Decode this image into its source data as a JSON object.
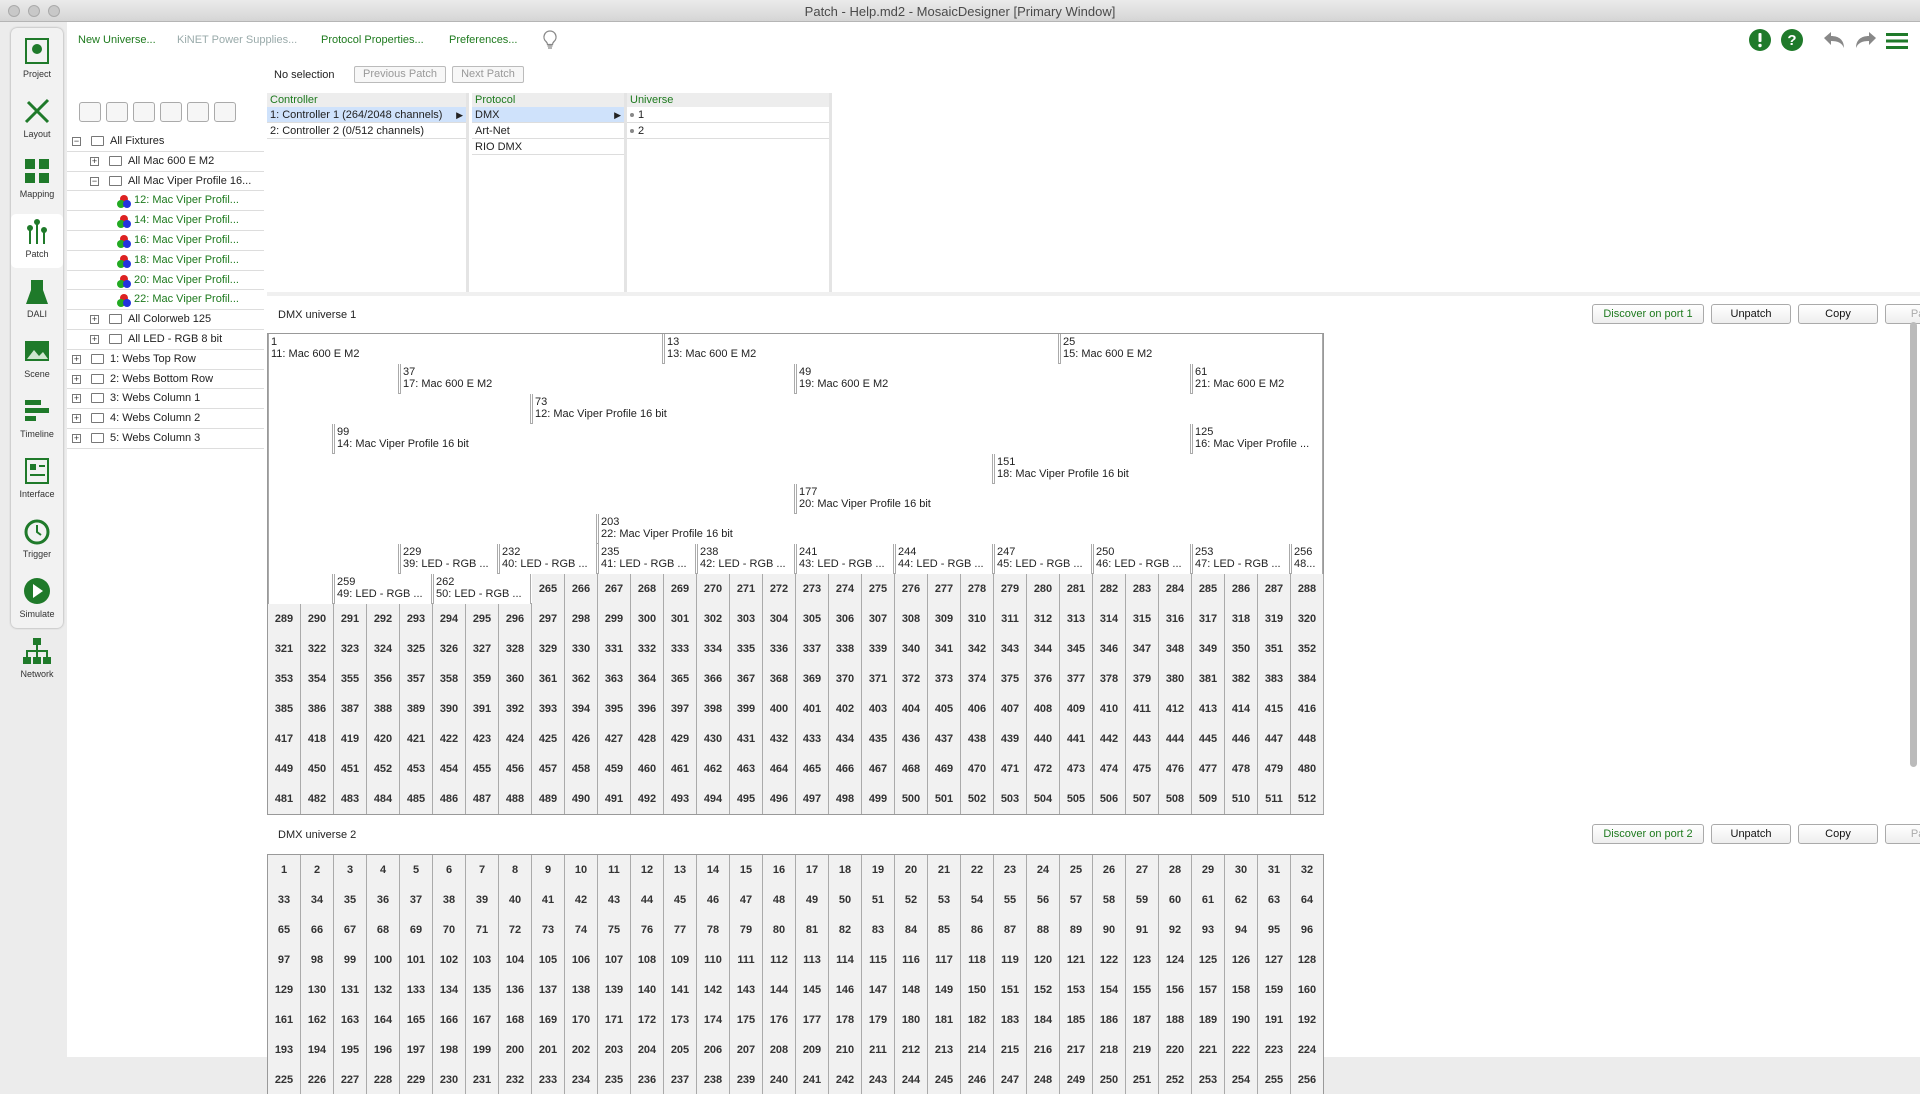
{
  "window": {
    "title": "Patch - Help.md2 - MosaicDesigner [Primary Window]"
  },
  "sidebar": {
    "items": [
      {
        "label": "Project",
        "icon": "project-icon"
      },
      {
        "label": "Layout",
        "icon": "layout-icon"
      },
      {
        "label": "Mapping",
        "icon": "mapping-icon"
      },
      {
        "label": "Patch",
        "icon": "patch-icon",
        "active": true
      },
      {
        "label": "DALI",
        "icon": "dali-icon"
      },
      {
        "label": "Scene",
        "icon": "scene-icon"
      },
      {
        "label": "Timeline",
        "icon": "timeline-icon"
      },
      {
        "label": "Interface",
        "icon": "interface-icon"
      },
      {
        "label": "Trigger",
        "icon": "trigger-icon"
      },
      {
        "label": "Simulate",
        "icon": "simulate-icon"
      },
      {
        "label": "Network",
        "icon": "network-icon"
      }
    ]
  },
  "toolbar": {
    "new_universe": "New Universe...",
    "kinet": "KiNET Power Supplies...",
    "protocol_props": "Protocol Properties...",
    "preferences": "Preferences...",
    "icons": [
      "lightbulb-icon",
      "warning-icon",
      "help-icon",
      "undo-icon",
      "redo-icon",
      "menu-icon"
    ]
  },
  "selection": {
    "status": "No selection",
    "prev": "Previous Patch",
    "next": "Next Patch"
  },
  "tree": {
    "items": [
      {
        "label": "All Fixtures",
        "indent": 0,
        "exp": "−",
        "kind": "folder"
      },
      {
        "label": "All Mac 600 E M2",
        "indent": 1,
        "exp": "+",
        "kind": "folder"
      },
      {
        "label": "All Mac Viper Profile 16...",
        "indent": 1,
        "exp": "−",
        "kind": "folder"
      },
      {
        "label": "12: Mac Viper Profil...",
        "indent": 2,
        "kind": "fixture"
      },
      {
        "label": "14: Mac Viper Profil...",
        "indent": 2,
        "kind": "fixture"
      },
      {
        "label": "16: Mac Viper Profil...",
        "indent": 2,
        "kind": "fixture"
      },
      {
        "label": "18: Mac Viper Profil...",
        "indent": 2,
        "kind": "fixture"
      },
      {
        "label": "20: Mac Viper Profil...",
        "indent": 2,
        "kind": "fixture"
      },
      {
        "label": "22: Mac Viper Profil...",
        "indent": 2,
        "kind": "fixture"
      },
      {
        "label": "All Colorweb 125",
        "indent": 1,
        "exp": "+",
        "kind": "folder"
      },
      {
        "label": "All LED - RGB 8 bit",
        "indent": 1,
        "exp": "+",
        "kind": "folder"
      },
      {
        "label": "1: Webs Top Row",
        "indent": 0,
        "exp": "+",
        "kind": "folder"
      },
      {
        "label": "2: Webs Bottom Row",
        "indent": 0,
        "exp": "+",
        "kind": "folder"
      },
      {
        "label": "3: Webs Column 1",
        "indent": 0,
        "exp": "+",
        "kind": "folder"
      },
      {
        "label": "4: Webs Column 2",
        "indent": 0,
        "exp": "+",
        "kind": "folder"
      },
      {
        "label": "5: Webs Column 3",
        "indent": 0,
        "exp": "+",
        "kind": "folder"
      }
    ]
  },
  "columns": {
    "controller": {
      "header": "Controller",
      "items": [
        "1: Controller 1 (264/2048 channels)",
        "2: Controller 2 (0/512 channels)"
      ]
    },
    "protocol": {
      "header": "Protocol",
      "items": [
        "DMX",
        "Art-Net",
        "RIO DMX"
      ]
    },
    "universe": {
      "header": "Universe",
      "items": [
        "1",
        "2"
      ]
    }
  },
  "universe1": {
    "title": "DMX universe 1",
    "buttons": {
      "discover": "Discover on port 1",
      "unpatch": "Unpatch",
      "copy": "Copy",
      "paste": "Paste"
    },
    "fixtures": [
      {
        "start": 1,
        "len": 12,
        "label": "11: Mac 600 E M2"
      },
      {
        "start": 13,
        "len": 12,
        "label": "13: Mac 600 E M2"
      },
      {
        "start": 25,
        "len": 12,
        "label": "15: Mac 600 E M2"
      },
      {
        "start": 37,
        "len": 12,
        "label": "17: Mac 600 E M2"
      },
      {
        "start": 49,
        "len": 12,
        "label": "19: Mac 600 E M2"
      },
      {
        "start": 61,
        "len": 12,
        "label": "21: Mac 600 E M2"
      },
      {
        "start": 73,
        "len": 26,
        "label": "12: Mac Viper Profile 16 bit"
      },
      {
        "start": 99,
        "len": 26,
        "label": "14: Mac Viper Profile 16 bit"
      },
      {
        "start": 125,
        "len": 26,
        "label": "16: Mac Viper Profile ..."
      },
      {
        "start": 151,
        "len": 26,
        "label": "18: Mac Viper Profile 16 bit"
      },
      {
        "start": 177,
        "len": 26,
        "label": "20: Mac Viper Profile 16 bit"
      },
      {
        "start": 203,
        "len": 26,
        "label": "22: Mac Viper Profile 16 bit"
      },
      {
        "start": 229,
        "len": 3,
        "label": "39: LED - RGB ..."
      },
      {
        "start": 232,
        "len": 3,
        "label": "40: LED - RGB ..."
      },
      {
        "start": 235,
        "len": 3,
        "label": "41: LED - RGB ..."
      },
      {
        "start": 238,
        "len": 3,
        "label": "42: LED - RGB ..."
      },
      {
        "start": 241,
        "len": 3,
        "label": "43: LED - RGB ..."
      },
      {
        "start": 244,
        "len": 3,
        "label": "44: LED - RGB ..."
      },
      {
        "start": 247,
        "len": 3,
        "label": "45: LED - RGB ..."
      },
      {
        "start": 250,
        "len": 3,
        "label": "46: LED - RGB ..."
      },
      {
        "start": 253,
        "len": 3,
        "label": "47: LED - RGB ..."
      },
      {
        "start": 256,
        "len": 3,
        "label": "48..."
      },
      {
        "start": 259,
        "len": 3,
        "label": "49: LED - RGB ..."
      },
      {
        "start": 262,
        "len": 3,
        "label": "50: LED - RGB ..."
      }
    ]
  },
  "universe2": {
    "title": "DMX universe 2",
    "buttons": {
      "discover": "Discover on port 2",
      "unpatch": "Unpatch",
      "copy": "Copy",
      "paste": "Paste"
    },
    "fixtures": []
  }
}
